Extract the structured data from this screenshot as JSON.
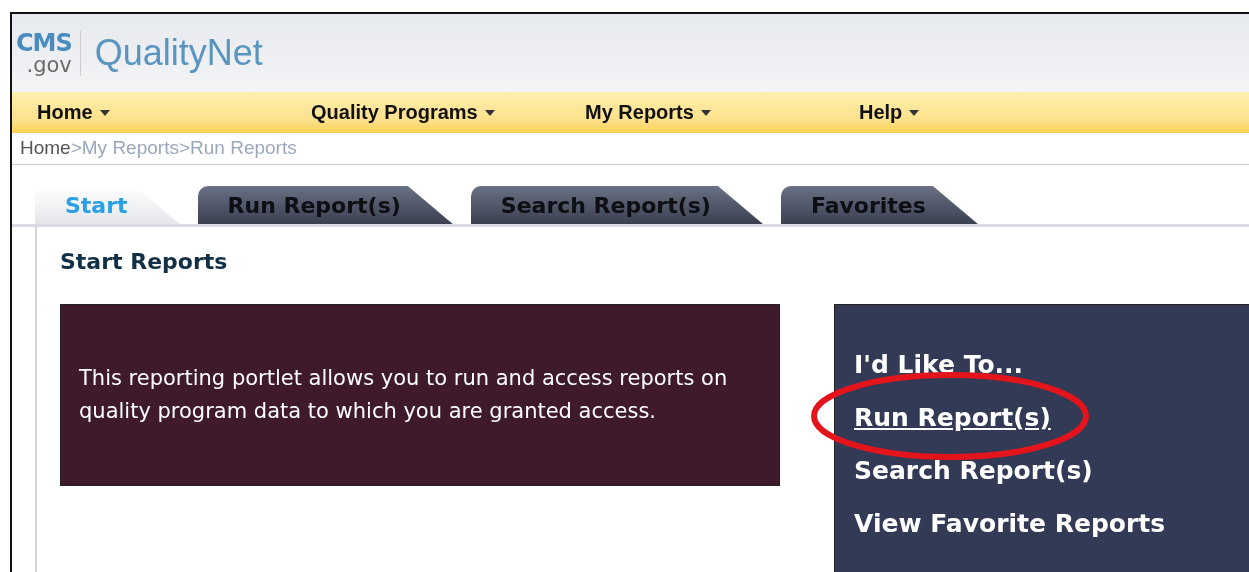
{
  "logo": {
    "mark_top": "CMS",
    "mark_bottom": ".gov",
    "name": "QualityNet"
  },
  "nav": [
    {
      "label": "Home"
    },
    {
      "label": "Quality Programs"
    },
    {
      "label": "My Reports"
    },
    {
      "label": "Help"
    }
  ],
  "breadcrumb": {
    "separator": ">",
    "items": [
      {
        "label": "Home",
        "current": true
      },
      {
        "label": "My Reports",
        "current": false
      },
      {
        "label": "Run Reports",
        "current": false
      }
    ]
  },
  "tabs": [
    {
      "label": "Start",
      "selected": true
    },
    {
      "label": "Run Report(s)",
      "selected": false
    },
    {
      "label": "Search Report(s)",
      "selected": false
    },
    {
      "label": "Favorites",
      "selected": false
    }
  ],
  "panel": {
    "title": "Start Reports",
    "intro": "This reporting portlet allows you to run and access reports on quality program data to which you are granted access.",
    "actions": {
      "heading": "I'd Like To...",
      "links": [
        {
          "label": "Run Report(s)",
          "circled": true,
          "underlined": true
        },
        {
          "label": "Search Report(s)",
          "circled": false,
          "underlined": false
        },
        {
          "label": "View Favorite Reports",
          "circled": false,
          "underlined": false
        }
      ]
    }
  }
}
